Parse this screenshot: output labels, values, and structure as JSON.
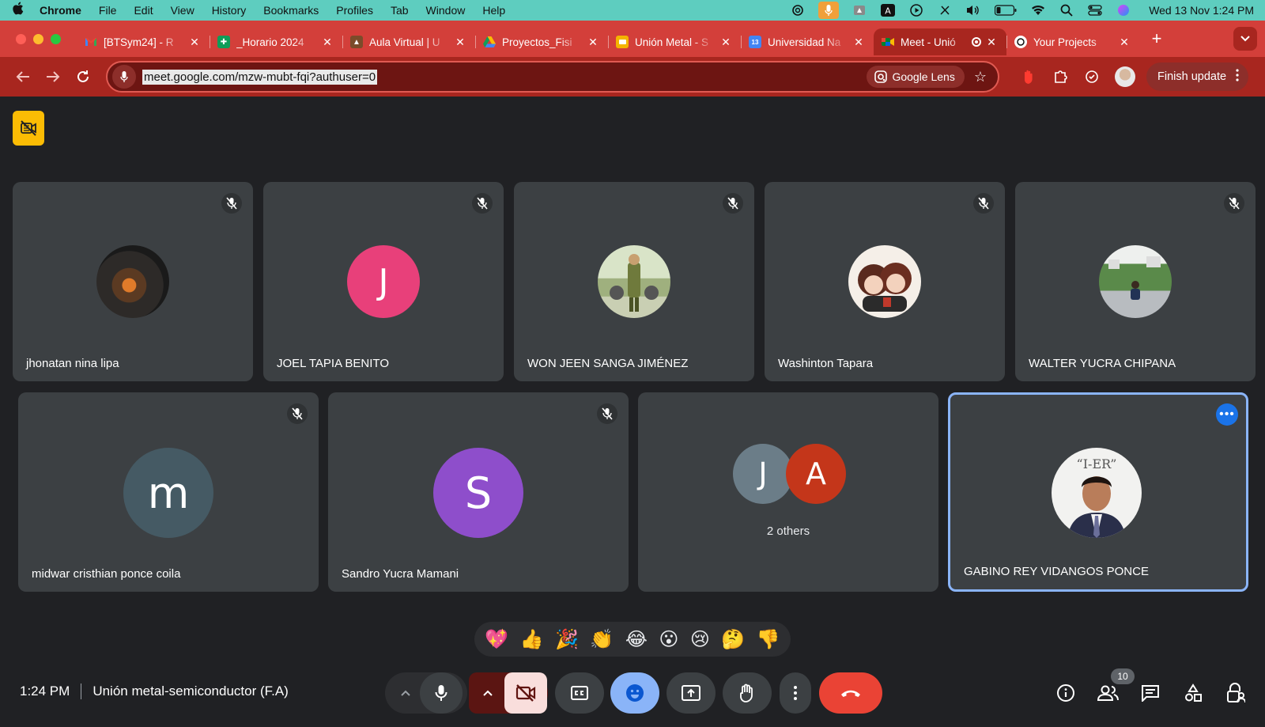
{
  "menubar": {
    "app": "Chrome",
    "items": [
      "File",
      "Edit",
      "View",
      "History",
      "Bookmarks",
      "Profiles",
      "Tab",
      "Window",
      "Help"
    ],
    "clock": "Wed 13 Nov  1:24 PM"
  },
  "tabs": [
    {
      "title": "[BTSym24] - R",
      "favicon": "gmail-icon",
      "color": "#ea4335"
    },
    {
      "title": "_Horario 2024",
      "favicon": "sheets-icon",
      "color": "#0f9d58"
    },
    {
      "title": "Aula Virtual | U",
      "favicon": "aula-virtual-icon",
      "color": "#7b4b2a"
    },
    {
      "title": "Proyectos_Fisi",
      "favicon": "drive-icon",
      "color": "#fbbc04"
    },
    {
      "title": "Unión Metal - S",
      "favicon": "slides-icon",
      "color": "#f4b400"
    },
    {
      "title": "Universidad Na",
      "favicon": "calendar-icon",
      "color": "#4285f4"
    },
    {
      "title": "Meet - Unió",
      "favicon": "meet-icon",
      "color": "#00897b",
      "active": true
    },
    {
      "title": "Your Projects",
      "favicon": "chatgpt-icon",
      "color": "#ffffff"
    }
  ],
  "toolbar": {
    "url": "meet.google.com/mzw-mubt-fqi?authuser=0",
    "lens_label": "Google Lens",
    "finish_update_label": "Finish update"
  },
  "participants_row1": [
    {
      "name": "jhonatan nina lipa",
      "avatar": "photo-dark"
    },
    {
      "name": "JOEL TAPIA BENITO",
      "avatar": "letter",
      "letter": "J",
      "color": "#e8407a"
    },
    {
      "name": "WON JEEN SANGA JIMÉNEZ",
      "avatar": "photo-soldier"
    },
    {
      "name": "Washinton Tapara",
      "avatar": "photo-anime"
    },
    {
      "name": "WALTER YUCRA CHIPANA",
      "avatar": "photo-park"
    }
  ],
  "participants_row2": [
    {
      "name": "midwar cristhian ponce coila",
      "avatar": "letter",
      "letter": "m",
      "color": "#455a64"
    },
    {
      "name": "Sandro Yucra Mamani",
      "avatar": "letter",
      "letter": "S",
      "color": "#8e4ecb"
    },
    {
      "others_label": "2 others",
      "letters": [
        {
          "letter": "J",
          "color": "#6b7d88"
        },
        {
          "letter": "A",
          "color": "#c4361a"
        }
      ]
    },
    {
      "name": "GABINO REY VIDANGOS PONCE",
      "avatar": "photo-self",
      "active": true
    }
  ],
  "reactions": [
    "💖",
    "👍",
    "🎉",
    "👏",
    "😂",
    "😮",
    "😢",
    "🤔",
    "👎"
  ],
  "bottom": {
    "time": "1:24 PM",
    "meeting_title": "Unión metal-semiconductor (F.A)",
    "participant_count": "10"
  }
}
